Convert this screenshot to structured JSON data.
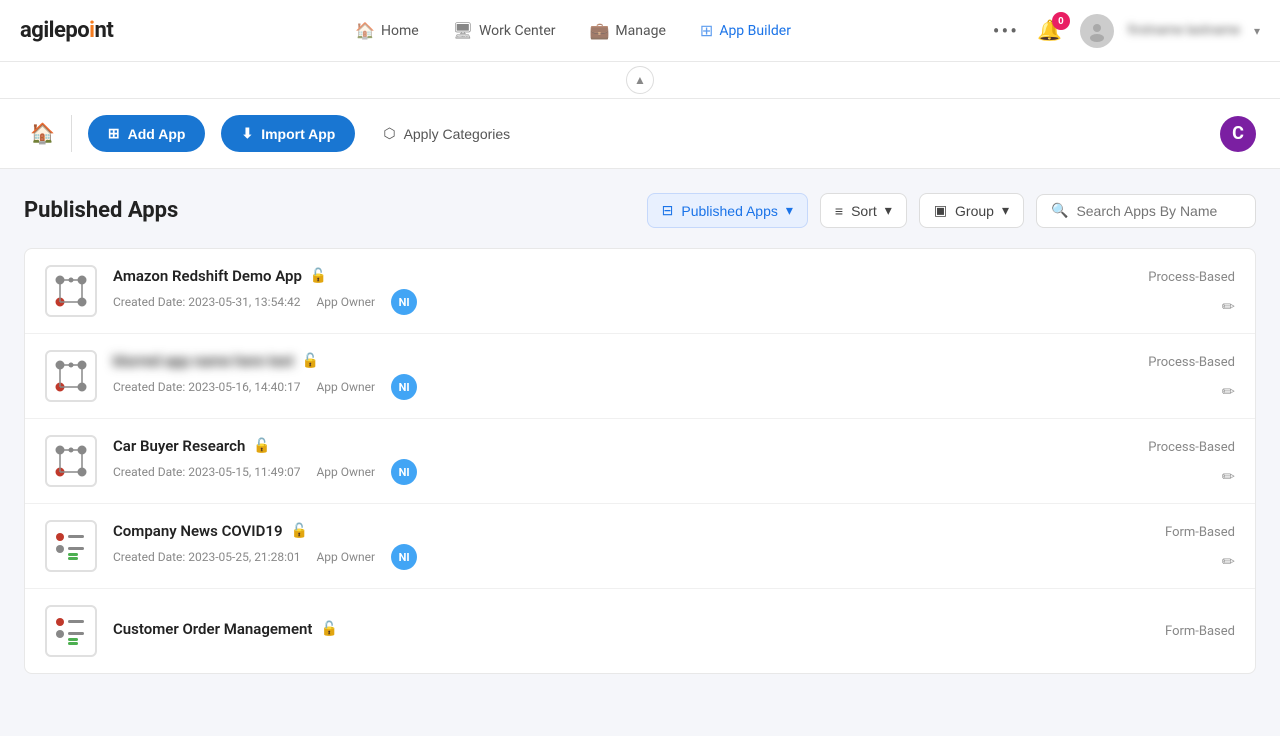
{
  "logo": {
    "text_before_dot": "agilepo",
    "dot": "●",
    "text_after_dot": "int"
  },
  "nav": {
    "items": [
      {
        "id": "home",
        "label": "Home",
        "icon": "🏠"
      },
      {
        "id": "work-center",
        "label": "Work Center",
        "icon": "🖥"
      },
      {
        "id": "manage",
        "label": "Manage",
        "icon": "💼"
      },
      {
        "id": "app-builder",
        "label": "App Builder",
        "icon": "⊞"
      }
    ],
    "notification_count": "0",
    "user_name": "firstname lastname",
    "more_icon": "•••"
  },
  "toolbar": {
    "home_icon": "⌂",
    "add_app_label": "Add App",
    "import_app_label": "Import App",
    "apply_categories_label": "Apply Categories",
    "user_initial": "C"
  },
  "filter": {
    "published_apps_label": "Published Apps",
    "sort_label": "Sort",
    "group_label": "Group",
    "search_placeholder": "Search Apps By Name"
  },
  "page": {
    "title": "Published Apps"
  },
  "apps": [
    {
      "id": "amazon-redshift",
      "name": "Amazon Redshift Demo App",
      "blurred": false,
      "created_date": "Created Date: 2023-05-31, 13:54:42",
      "owner_label": "App Owner",
      "owner_initials": "NI",
      "type": "Process-Based",
      "icon_type": "process"
    },
    {
      "id": "blurred-app",
      "name": "██████████ ██ ████",
      "blurred": true,
      "created_date": "Created Date: 2023-05-16, 14:40:17",
      "owner_label": "App Owner",
      "owner_initials": "NI",
      "type": "Process-Based",
      "icon_type": "process"
    },
    {
      "id": "car-buyer",
      "name": "Car Buyer Research",
      "blurred": false,
      "created_date": "Created Date: 2023-05-15, 11:49:07",
      "owner_label": "App Owner",
      "owner_initials": "NI",
      "type": "Process-Based",
      "icon_type": "process"
    },
    {
      "id": "company-news",
      "name": "Company News COVID19",
      "blurred": false,
      "created_date": "Created Date: 2023-05-25, 21:28:01",
      "owner_label": "App Owner",
      "owner_initials": "NI",
      "type": "Form-Based",
      "icon_type": "form"
    },
    {
      "id": "customer-order",
      "name": "Customer Order Management",
      "blurred": false,
      "created_date": "",
      "owner_label": "",
      "owner_initials": "",
      "type": "Form-Based",
      "icon_type": "form"
    }
  ]
}
